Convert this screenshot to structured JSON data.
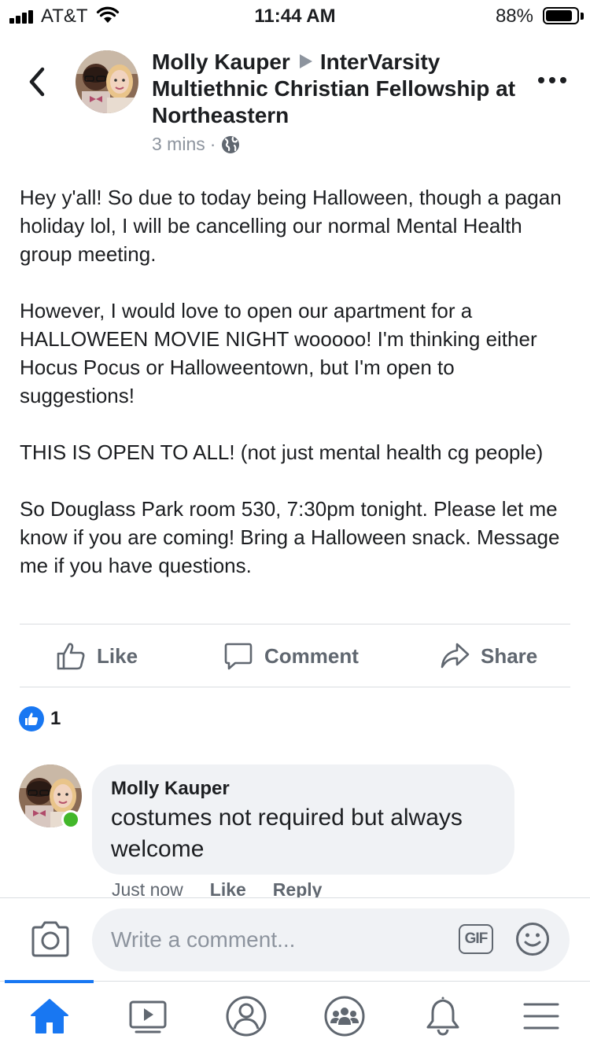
{
  "status_bar": {
    "carrier": "AT&T",
    "time": "11:44 AM",
    "battery_percent": "88%",
    "battery_level": 0.88
  },
  "post": {
    "author": "Molly Kauper",
    "group": "InterVarsity Multiethnic Christian Fellowship at Northeastern",
    "time_ago": "3 mins",
    "privacy_icon": "globe-icon",
    "paragraphs": [
      "Hey y'all! So due to today being Halloween, though a pagan holiday lol, I will be cancelling our normal Mental Health group meeting.",
      "However, I would love to open our apartment for a HALLOWEEN MOVIE NIGHT wooooo! I'm thinking either Hocus Pocus or Halloweentown, but I'm open to suggestions!",
      "THIS IS OPEN TO ALL! (not just mental health cg people)",
      "So Douglass Park room 530, 7:30pm tonight. Please let me know if you are coming! Bring a Halloween snack. Message me if you have questions."
    ]
  },
  "actions": {
    "like": "Like",
    "comment": "Comment",
    "share": "Share"
  },
  "reactions": {
    "count": "1",
    "icon": "thumbs-up-icon"
  },
  "comment": {
    "author": "Molly Kauper",
    "text": "costumes not required but always welcome",
    "time": "Just now",
    "like": "Like",
    "reply": "Reply"
  },
  "composer": {
    "placeholder": "Write a comment...",
    "gif_label": "GIF"
  },
  "tabs": [
    {
      "name": "home",
      "icon": "home-icon",
      "active": true
    },
    {
      "name": "watch",
      "icon": "video-icon",
      "active": false
    },
    {
      "name": "profile",
      "icon": "profile-icon",
      "active": false
    },
    {
      "name": "groups",
      "icon": "groups-icon",
      "active": false
    },
    {
      "name": "notifications",
      "icon": "bell-icon",
      "active": false
    },
    {
      "name": "menu",
      "icon": "menu-icon",
      "active": false
    }
  ],
  "colors": {
    "accent": "#1877f2",
    "online": "#42b72a",
    "secondary_text": "#606770"
  }
}
